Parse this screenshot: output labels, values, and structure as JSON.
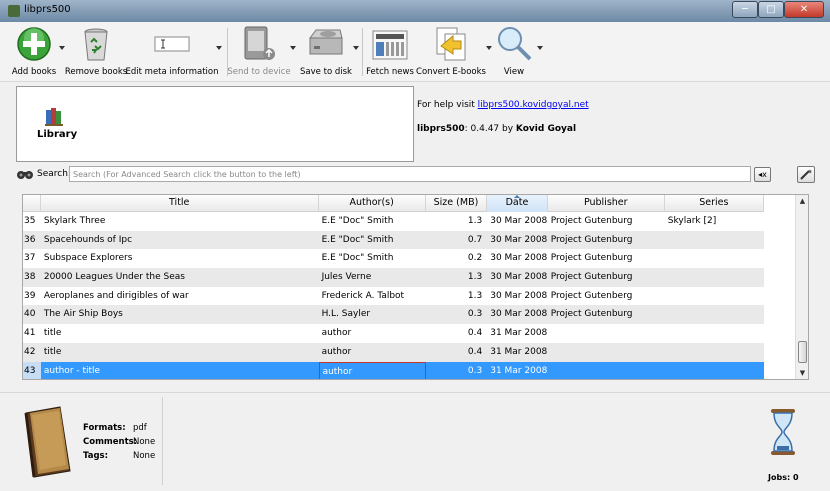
{
  "window": {
    "title": "libprs500",
    "minimize_glyph": "─",
    "maximize_glyph": "□",
    "close_glyph": "✕"
  },
  "toolbar": {
    "add_books": "Add books",
    "remove_books": "Remove books",
    "edit_meta": "Edit meta information",
    "send_to_device": "Send to device",
    "save_to_disk": "Save to disk",
    "fetch_news": "Fetch news",
    "convert_ebooks": "Convert E-books",
    "view": "View"
  },
  "library": {
    "label": "Library"
  },
  "help": {
    "prefix": "For help visit ",
    "link": "libprs500.kovidgoyal.net"
  },
  "version": {
    "app": "libprs500",
    "number": ": 0.4.47 by ",
    "author": "Kovid Goyal"
  },
  "search": {
    "label": "Search:",
    "placeholder": "Search (For Advanced Search click the button to the left)",
    "clear_glyph": "◂x"
  },
  "table": {
    "columns": [
      "Title",
      "Author(s)",
      "Size (MB)",
      "Date",
      "Publisher",
      "Series"
    ],
    "sorted_column": "Date",
    "rows": [
      {
        "num": "35",
        "title": "Skylark Three",
        "author": "E.E \"Doc\" Smith",
        "size": "1.3",
        "date": "30 Mar 2008",
        "publisher": "Project Gutenburg",
        "series": "Skylark [2]"
      },
      {
        "num": "36",
        "title": "Spacehounds of Ipc",
        "author": "E.E \"Doc\" Smith",
        "size": "0.7",
        "date": "30 Mar 2008",
        "publisher": "Project Gutenburg",
        "series": ""
      },
      {
        "num": "37",
        "title": "Subspace Explorers",
        "author": "E.E \"Doc\" Smith",
        "size": "0.2",
        "date": "30 Mar 2008",
        "publisher": "Project Gutenburg",
        "series": ""
      },
      {
        "num": "38",
        "title": "20000 Leagues Under the Seas",
        "author": "Jules Verne",
        "size": "1.3",
        "date": "30 Mar 2008",
        "publisher": "Project Gutenburg",
        "series": ""
      },
      {
        "num": "39",
        "title": "Aeroplanes and dirigibles of war",
        "author": "Frederick A. Talbot",
        "size": "1.3",
        "date": "30 Mar 2008",
        "publisher": "Project Gutenberg",
        "series": ""
      },
      {
        "num": "40",
        "title": "The Air Ship Boys",
        "author": "H.L. Sayler",
        "size": "0.3",
        "date": "30 Mar 2008",
        "publisher": "Project Gutenburg",
        "series": ""
      },
      {
        "num": "41",
        "title": "title",
        "author": "author",
        "size": "0.4",
        "date": "31 Mar 2008",
        "publisher": "",
        "series": ""
      },
      {
        "num": "42",
        "title": "title",
        "author": "author",
        "size": "0.4",
        "date": "31 Mar 2008",
        "publisher": "",
        "series": ""
      },
      {
        "num": "43",
        "title": "author - title",
        "author": "author",
        "size": "0.3",
        "date": "31 Mar 2008",
        "publisher": "",
        "series": ""
      }
    ],
    "selected_row": "43"
  },
  "details": {
    "formats_label": "Formats:",
    "formats_value": "pdf",
    "comments_label": "Comments:",
    "comments_value": "None",
    "tags_label": "Tags:",
    "tags_value": "None"
  },
  "jobs": {
    "label": "Jobs: 0"
  },
  "colors": {
    "selection": "#3399ff",
    "row_alt": "#e9e9e9",
    "link": "#0000ee"
  }
}
